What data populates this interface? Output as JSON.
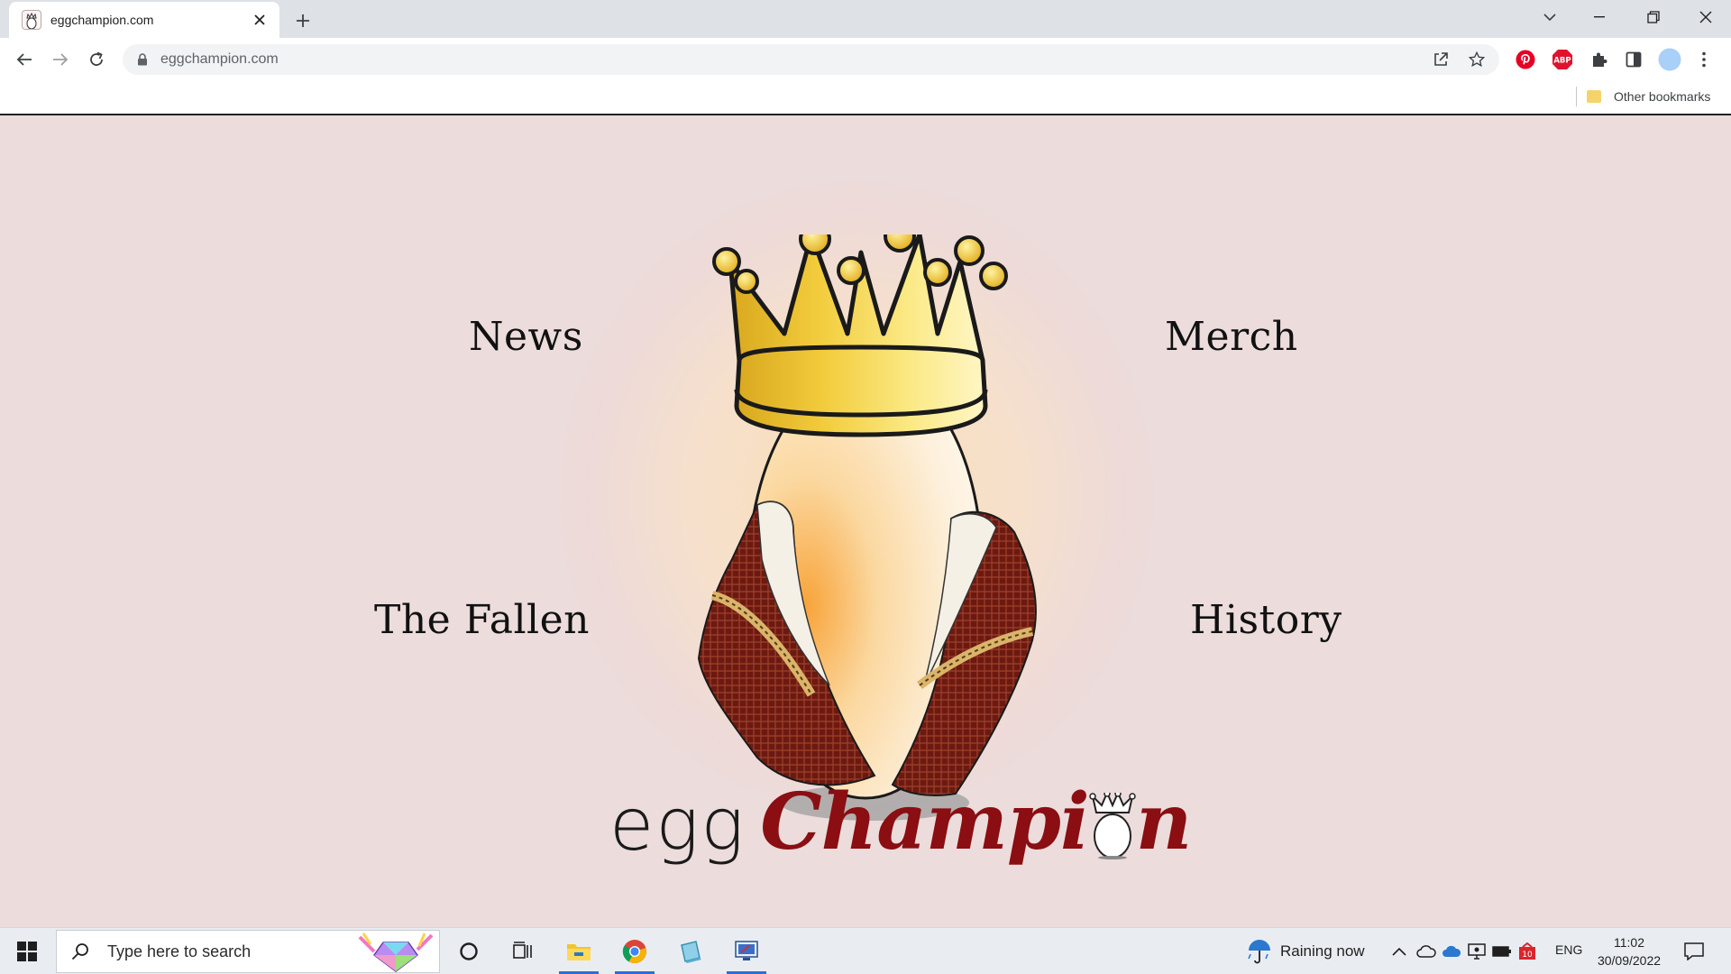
{
  "browser": {
    "tab_title": "eggchampion.com",
    "url": "eggchampion.com",
    "other_bookmarks_label": "Other bookmarks",
    "icons": {
      "back": "arrow-left-icon",
      "forward": "arrow-right-icon",
      "reload": "reload-icon",
      "lock": "lock-icon",
      "share": "share-icon",
      "star": "star-icon",
      "pinterest": "pinterest-icon",
      "adblock": "adblock-icon",
      "extensions": "puzzle-icon",
      "side_panel": "side-panel-icon",
      "profile": "profile-avatar",
      "menu": "kebab-menu-icon"
    },
    "adblock_label": "ABP"
  },
  "page": {
    "nav": {
      "news": "News",
      "merch": "Merch",
      "fallen": "The Fallen",
      "history": "History"
    },
    "brand": {
      "egg": "egg",
      "champ_before": "Champi",
      "champ_after": "n"
    },
    "colors": {
      "background": "#ecdcdc",
      "brand_red": "#8a0e12",
      "crown_gold": "#f2cc3c"
    }
  },
  "taskbar": {
    "search_placeholder": "Type here to search",
    "weather": "Raining now",
    "language": "ENG",
    "time": "11:02",
    "date": "30/09/2022",
    "battery_badge": "10"
  }
}
